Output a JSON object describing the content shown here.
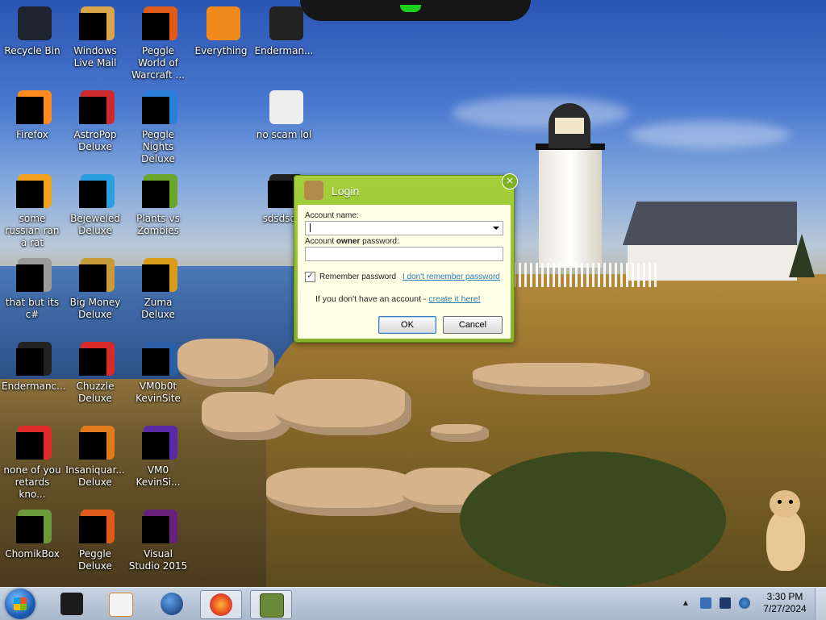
{
  "desktop_icons": [
    {
      "label": "Recycle Bin",
      "icon": "recycle-bin-icon",
      "color": "#1e2430"
    },
    {
      "label": "Windows Live Mail",
      "icon": "windows-live-mail-icon",
      "color": "#d9a64c"
    },
    {
      "label": "Peggle World of Warcraft ...",
      "icon": "peggle-wow-icon",
      "color": "#e05a1a"
    },
    {
      "label": "Everything",
      "icon": "everything-search-icon",
      "color": "#f08a1c"
    },
    {
      "label": "Enderman...",
      "icon": "terminal-icon",
      "color": "#222222"
    },
    {
      "label": "Firefox",
      "icon": "firefox-icon",
      "color": "#ff8a1e"
    },
    {
      "label": "AstroPop Deluxe",
      "icon": "astropop-icon",
      "color": "#cc2a2a"
    },
    {
      "label": "Peggle Nights Deluxe",
      "icon": "peggle-nights-icon",
      "color": "#2a7fd9"
    },
    {
      "label": "no scam lol",
      "icon": "document-icon",
      "color": "#eeeeee"
    },
    {
      "label": "some russian ran a rat",
      "icon": "java-icon",
      "color": "#f0a21e"
    },
    {
      "label": "Bejeweled Deluxe",
      "icon": "bejeweled-icon",
      "color": "#2a9fe0"
    },
    {
      "label": "Plants vs Zombies",
      "icon": "plants-vs-zombies-icon",
      "color": "#6aa62a"
    },
    {
      "label": "sdsdsd...",
      "icon": "terminal-icon",
      "color": "#222222"
    },
    {
      "label": "that but its c#",
      "icon": "files-icon",
      "color": "#9a9a9a"
    },
    {
      "label": "Big Money Deluxe",
      "icon": "money-bag-icon",
      "color": "#c79a3a"
    },
    {
      "label": "Zuma Deluxe",
      "icon": "zuma-icon",
      "color": "#d99b1a"
    },
    {
      "label": "Endermanc...",
      "icon": "terminal-icon",
      "color": "#222222"
    },
    {
      "label": "Chuzzle Deluxe",
      "icon": "chuzzle-icon",
      "color": "#d92a2a"
    },
    {
      "label": "VM0b0t KevinSite",
      "icon": "vm-icon",
      "color": "#2a5fa6"
    },
    {
      "label": "none of you retards kno...",
      "icon": "opera-icon",
      "color": "#e02a2a"
    },
    {
      "label": "Insaniquar... Deluxe",
      "icon": "insaniquarium-icon",
      "color": "#e07a1a"
    },
    {
      "label": "VM0 KevinSi...",
      "icon": "vm-icon",
      "color": "#5a2aa6"
    },
    {
      "label": "ChomikBox",
      "icon": "chomikbox-icon",
      "color": "#6a9a3a"
    },
    {
      "label": "Peggle Deluxe",
      "icon": "peggle-icon",
      "color": "#e05a1a"
    },
    {
      "label": "Visual Studio 2015",
      "icon": "visual-studio-icon",
      "color": "#68217a"
    }
  ],
  "login_dialog": {
    "title": "Login",
    "account_name_label": "Account name:",
    "password_label_prefix": "Account ",
    "password_label_bold": "owner",
    "password_label_suffix": " password:",
    "account_name_value": "",
    "password_value": "",
    "remember_label": "Remember password",
    "remember_checked": true,
    "forgot_link": "I don't remember password",
    "no_account_text": "If you don't have an account - ",
    "create_link": "create it here!",
    "ok_label": "OK",
    "cancel_label": "Cancel",
    "close_glyph": "×"
  },
  "taskbar": {
    "pinned": [
      {
        "name": "start-button"
      },
      {
        "name": "terminal",
        "icon": "terminal-icon"
      },
      {
        "name": "media-player",
        "icon": "media-player-icon"
      },
      {
        "name": "globe",
        "icon": "globe-icon"
      },
      {
        "name": "firefox",
        "icon": "firefox-icon"
      },
      {
        "name": "chomikbox",
        "icon": "chomikbox-icon",
        "active": true
      }
    ],
    "clock_time": "3:30 PM",
    "clock_date": "7/27/2024",
    "tray_overflow_glyph": "▲"
  },
  "colors": {
    "dialog_green": "#a7cf3c",
    "dialog_body": "#ffffe6",
    "link": "#2a7ab0",
    "taskbar": "#b8c5d8"
  }
}
